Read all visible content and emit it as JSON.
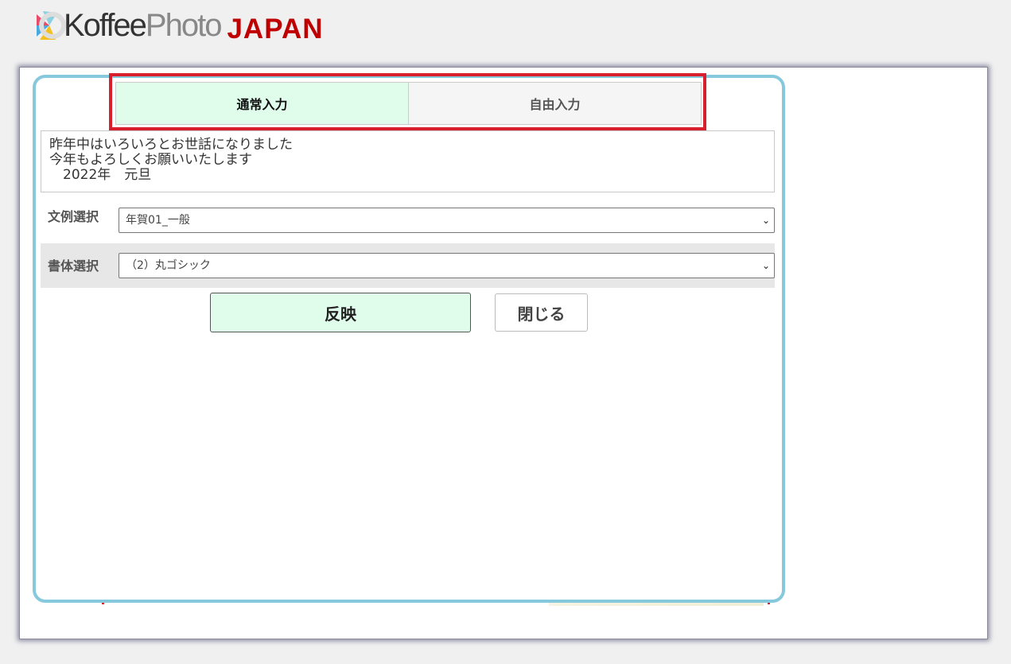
{
  "header": {
    "logo_main": "Koffee",
    "logo_photo": "Photo",
    "logo_region": "JAPAN"
  },
  "tabs": [
    {
      "label": "通常入力",
      "active": true
    },
    {
      "label": "自由入力",
      "active": false
    }
  ],
  "message": {
    "text": "昨年中はいろいろとお世話になりました\n今年もよろしくお願いいたします\n　2022年　元旦"
  },
  "template_select": {
    "label": "文例選択",
    "value": "年賀01_一般"
  },
  "font_select": {
    "label": "書体選択",
    "value": "（2）丸ゴシック"
  },
  "buttons": {
    "apply": "反映",
    "close": "閉じる"
  },
  "colors": {
    "accent_red": "#d81f2d",
    "panel_border": "#86c8dc",
    "active_tab_bg": "#e0fdec",
    "logo_region": "#c00000"
  },
  "icons": {
    "select_arrow": "chevron-down-icon",
    "logo": "koffeephoto-logo-mark"
  }
}
